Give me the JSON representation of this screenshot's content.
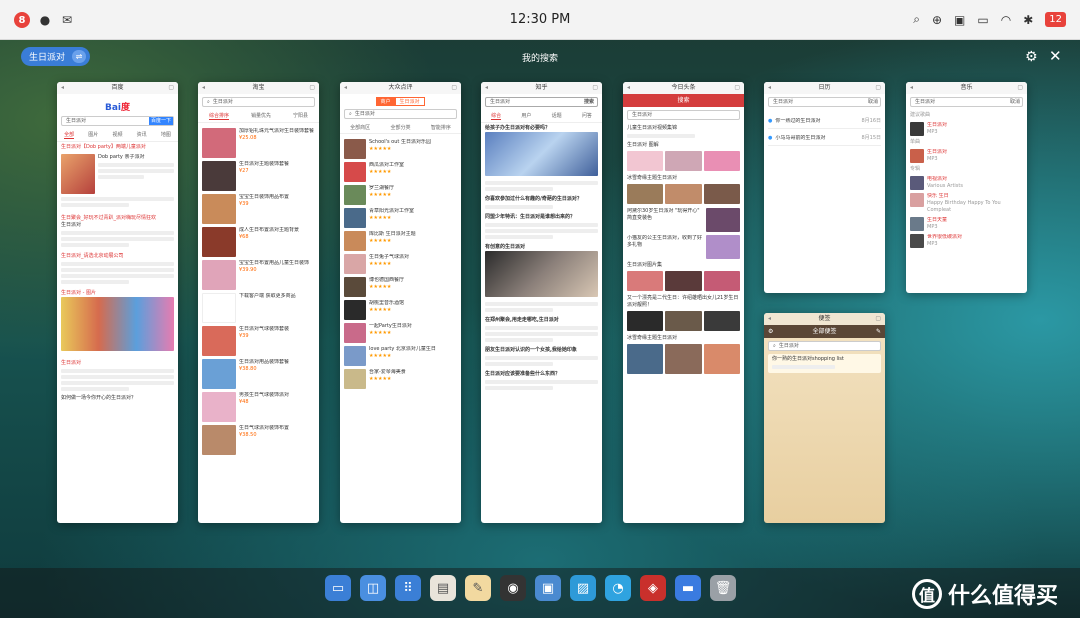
{
  "statusbar": {
    "notification_count": "8",
    "clock": "12:30 PM",
    "battery": "12"
  },
  "search_pill": {
    "query": "生日派对"
  },
  "header": {
    "title": "我的搜索"
  },
  "cards": {
    "baidu": {
      "title": "百度",
      "query": "生日派对",
      "search_btn": "百度一下",
      "tabs": [
        "全部",
        "图片",
        "视频",
        "资讯",
        "地图",
        "知道",
        "贴吧"
      ],
      "r1": "生日派对【Dob party】两端儿童派对",
      "r1_sub": "Dob party 亲子派对",
      "r2": "生日聚会_好玩不过青趴_派对嗨玩尽情狂欢",
      "r2_sub": "生日派对",
      "r3": "生日派对_请选北京动展公司",
      "r4": "生日派对 - 图片",
      "r5": "生日派对",
      "r6": "如何做一场今你开心的生日派对？"
    },
    "taobao": {
      "title": "淘宝",
      "query": "生日派对",
      "sort": [
        "综合排序",
        "销量优先",
        "宁阳县"
      ],
      "items": [
        "加厚铝礼珠元气派对生日装饰套餐",
        "生日派对主题装饰套餐",
        "宝宝生日装饰用品布置",
        "成人生日布置派对主题背景",
        "宝宝生日布置用品儿童生日装饰",
        "下载客户端 获取更多商品",
        "生日派对气球装饰套装",
        "生日派对用品装饰套餐",
        "男孩生日气球装饰派对",
        "生日气球派对装饰布置"
      ],
      "prices": [
        "¥25.08",
        "¥27",
        "¥39",
        "¥68",
        "¥39.90",
        "¥39",
        "¥38.80",
        "¥48",
        "¥38.50"
      ]
    },
    "dianping": {
      "title": "大众点评",
      "tab_a": "商户",
      "tab_b": "生日派对",
      "query": "生日派对",
      "filters": [
        "全部商区",
        "全部分类",
        "智能排序"
      ],
      "items": [
        "School's out 生日派对乐园",
        "西瓜派对工作室",
        "罗兰湖餐厅",
        "青草阳光派对工作室",
        "库比斯 生日派对主题",
        "生日兔子气球派对",
        "博也德国西餐厅",
        "胡桃里音乐酒馆",
        "一起Party生日派对",
        "love party 北京派对儿童生日",
        "吾家-爱琴海美食"
      ]
    },
    "zhihu": {
      "title": "知乎",
      "tabs": [
        "综合",
        "用户",
        "话题",
        "问答"
      ],
      "query": "生日派对",
      "search_btn": "搜索",
      "q1": "给孩子办生日派对有必要吗？",
      "q2": "你喜欢参加过什么有趣的/奇葩的生日派对？",
      "q3": "同盟少年特讯：生日派对是谁想出来的？",
      "q4": "有创意的生日派对",
      "q5": "在郑州聚会,用走走哪吃,生日派对",
      "q6": "朋友生日派对认识的一个女孩,我给她印象",
      "q7": "生日派对应该要准备些什么东西？"
    },
    "toutiao": {
      "title": "今日头条",
      "search": "搜索",
      "query": "生日派对",
      "h1": "儿童生日派对视频集锦",
      "h2": "生日派对 图解",
      "h3": "冰雪奇缘主题生日派对",
      "h4": "阿黛尔30岁生日派对 \"玩得开心\" 简直变装色",
      "h5": "小猫友的公主生日派对，收到了好多礼物",
      "h6": "生日派对图片集",
      "h7": "又一个漂亮是二代生日：许绍雄晒出女儿21岁生日派对靓照！",
      "h8": "冰雪奇缘主题生日派对"
    },
    "calendar": {
      "title": "日历",
      "query": "生日派对",
      "search_btn": "取消",
      "item1": "你一熟过的生日派对",
      "item2": "小马马哥前的生日派对",
      "date1": "8月16日",
      "date2": "8月15日"
    },
    "music": {
      "title": "音乐",
      "query": "生日派对",
      "search_btn": "取消",
      "section1": "建议歌曲",
      "section2": "单曲",
      "section3": "专辑",
      "songs": [
        "生日派对",
        "生日派对",
        "电视派对",
        "快乐 生日",
        "生日天童",
        "世界很低碳派对"
      ],
      "artists": [
        "MP3",
        "MP3",
        "Various Artists",
        "Happy Birthday Happy To You Compleat",
        "MP3",
        "MP3"
      ]
    },
    "notes": {
      "title": "便签",
      "header": "全部便签",
      "query": "生日派对",
      "note1": "你一熟的生日派对shopping list"
    }
  },
  "dock": {
    "icons": [
      "screen-icon",
      "notes-app-icon",
      "grid-icon",
      "card-icon",
      "pencil-icon",
      "music-icon",
      "photos-icon",
      "preview-icon",
      "browser-icon",
      "red-app-icon",
      "messages-icon",
      "trash-icon"
    ]
  },
  "watermark": {
    "text": "什么值得买",
    "logo": "值"
  }
}
